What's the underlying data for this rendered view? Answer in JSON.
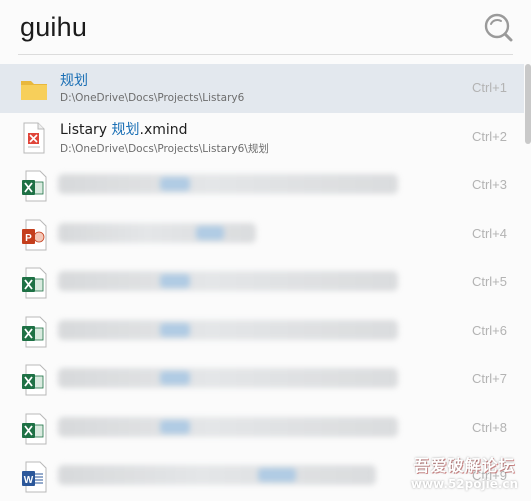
{
  "search": {
    "query": "guihu"
  },
  "results": [
    {
      "type": "folder",
      "title_plain": "",
      "title_hl": "规划",
      "title_suffix": "",
      "path": "D:\\OneDrive\\Docs\\Projects\\Listary6",
      "shortcut": "Ctrl+1",
      "selected": true
    },
    {
      "type": "xmind",
      "title_plain": "Listary ",
      "title_hl": "规划",
      "title_suffix": ".xmind",
      "path": "D:\\OneDrive\\Docs\\Projects\\Listary6\\规划",
      "shortcut": "Ctrl+2",
      "selected": false
    },
    {
      "type": "excel",
      "blurred": true,
      "shortcut": "Ctrl+3"
    },
    {
      "type": "powerpoint",
      "blurred": true,
      "shortcut": "Ctrl+4"
    },
    {
      "type": "excel",
      "blurred": true,
      "shortcut": "Ctrl+5"
    },
    {
      "type": "excel",
      "blurred": true,
      "shortcut": "Ctrl+6"
    },
    {
      "type": "excel",
      "blurred": true,
      "shortcut": "Ctrl+7"
    },
    {
      "type": "excel",
      "blurred": true,
      "shortcut": "Ctrl+8"
    },
    {
      "type": "word",
      "blurred": true,
      "shortcut": "Ctrl+9"
    }
  ],
  "watermark": {
    "line1": "吾爱破解论坛",
    "line2": "www.52pojie.cn"
  },
  "colors": {
    "highlight": "#1a6fb5",
    "selected_row": "#e3e8ee",
    "shortcut": "#b3b3b3"
  }
}
